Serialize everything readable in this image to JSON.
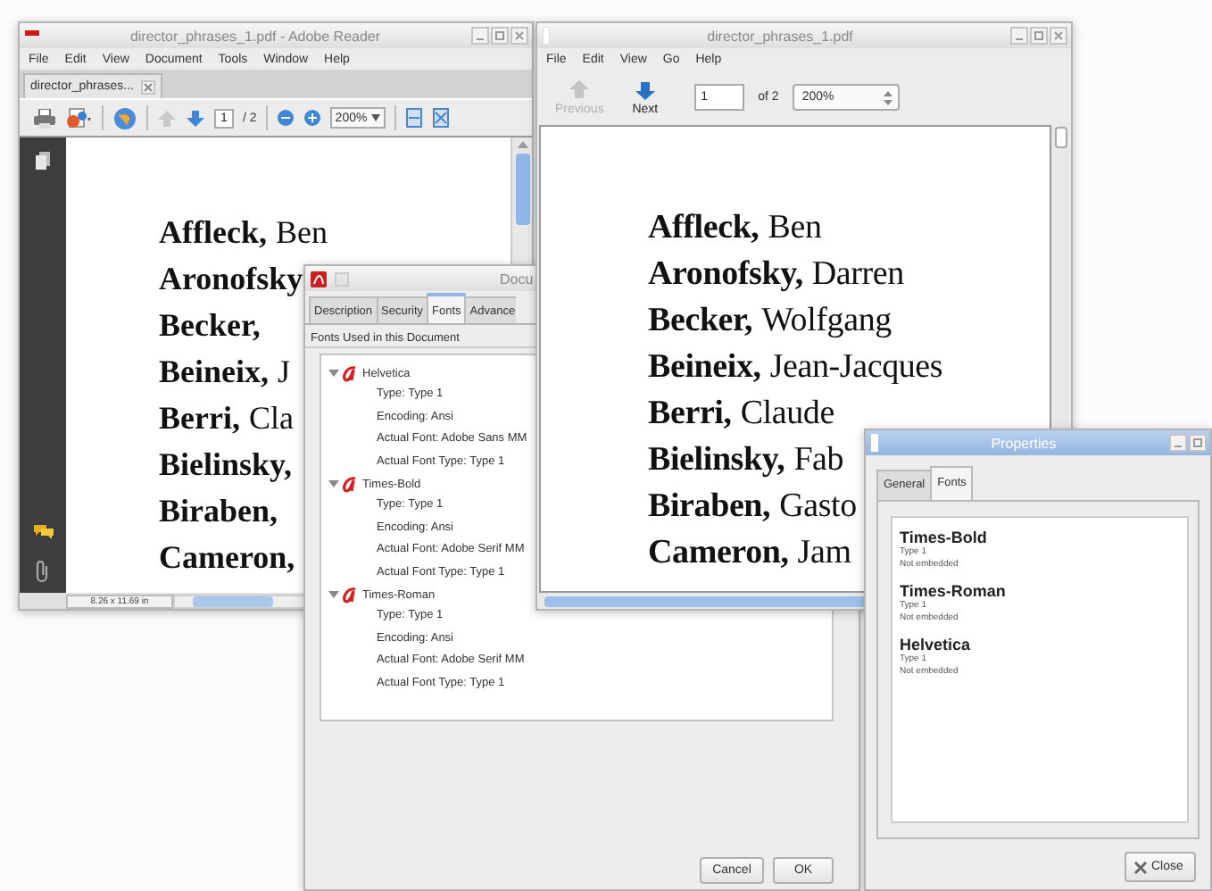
{
  "reader_window": {
    "title": "director_phrases_1.pdf - Adobe Reader",
    "menu": [
      "File",
      "Edit",
      "View",
      "Document",
      "Tools",
      "Window",
      "Help"
    ],
    "tab": "director_phrases...",
    "toolbar": {
      "page": "1",
      "page_count": "/ 2",
      "zoom": "200%"
    },
    "names": [
      {
        "last": "Affleck,",
        "first": "Ben"
      },
      {
        "last": "Aronofsky"
      },
      {
        "last": "Becker,"
      },
      {
        "last": "Beineix,",
        "first": "J"
      },
      {
        "last": "Berri,",
        "first": "Cla"
      },
      {
        "last": "Bielinsky,"
      },
      {
        "last": "Biraben,"
      },
      {
        "last": "Cameron,"
      }
    ],
    "status": "8.26 x 11.69 in"
  },
  "document_properties_dialog": {
    "title": "Docu",
    "tabs": [
      {
        "label": "Description",
        "selected": false
      },
      {
        "label": "Security",
        "selected": false
      },
      {
        "label": "Fonts",
        "selected": true
      },
      {
        "label": "Advance",
        "selected": false
      }
    ],
    "section_title": "Fonts Used in this Document",
    "fonts": [
      {
        "name": "Helvetica",
        "expanded": true,
        "details": [
          "Type: Type 1",
          "Encoding: Ansi",
          "Actual Font: Adobe Sans MM",
          "Actual Font Type: Type 1"
        ]
      },
      {
        "name": "Times-Bold",
        "expanded": true,
        "details": [
          "Type: Type 1",
          "Encoding: Ansi",
          "Actual Font: Adobe Serif MM",
          "Actual Font Type: Type 1"
        ]
      },
      {
        "name": "Times-Roman",
        "expanded": true,
        "details": [
          "Type: Type 1",
          "Encoding: Ansi",
          "Actual Font: Adobe Serif MM",
          "Actual Font Type: Type 1"
        ]
      }
    ],
    "buttons": [
      "Cancel",
      "OK"
    ]
  },
  "viewer_window": {
    "title": "director_phrases_1.pdf",
    "menu": [
      "File",
      "Edit",
      "View",
      "Go",
      "Help"
    ],
    "toolbar": {
      "previous": {
        "label": "Previous",
        "disabled": true
      },
      "next": {
        "label": "Next",
        "disabled": false
      },
      "page": "1",
      "page_count": "of 2",
      "zoom": "200%"
    },
    "names": [
      {
        "last": "Affleck,",
        "first": "Ben"
      },
      {
        "last": "Aronofsky,",
        "first": "Darren"
      },
      {
        "last": "Becker,",
        "first": "Wolfgang"
      },
      {
        "last": "Beineix,",
        "first": "Jean-Jacques"
      },
      {
        "last": "Berri,",
        "first": "Claude"
      },
      {
        "last": "Bielinsky,",
        "first": "Fab"
      },
      {
        "last": "Biraben,",
        "first": "Gasto"
      },
      {
        "last": "Cameron,",
        "first": "Jam"
      }
    ]
  },
  "properties_dialog": {
    "title": "Properties",
    "tabs": [
      {
        "label": "General",
        "selected": false
      },
      {
        "label": "Fonts",
        "selected": true
      }
    ],
    "fonts": [
      {
        "name": "Times-Bold",
        "type": "Type 1",
        "embedding": "Not embedded"
      },
      {
        "name": "Times-Roman",
        "type": "Type 1",
        "embedding": "Not embedded"
      },
      {
        "name": "Helvetica",
        "type": "Type 1",
        "embedding": "Not embedded"
      }
    ],
    "close_button": "Close"
  }
}
